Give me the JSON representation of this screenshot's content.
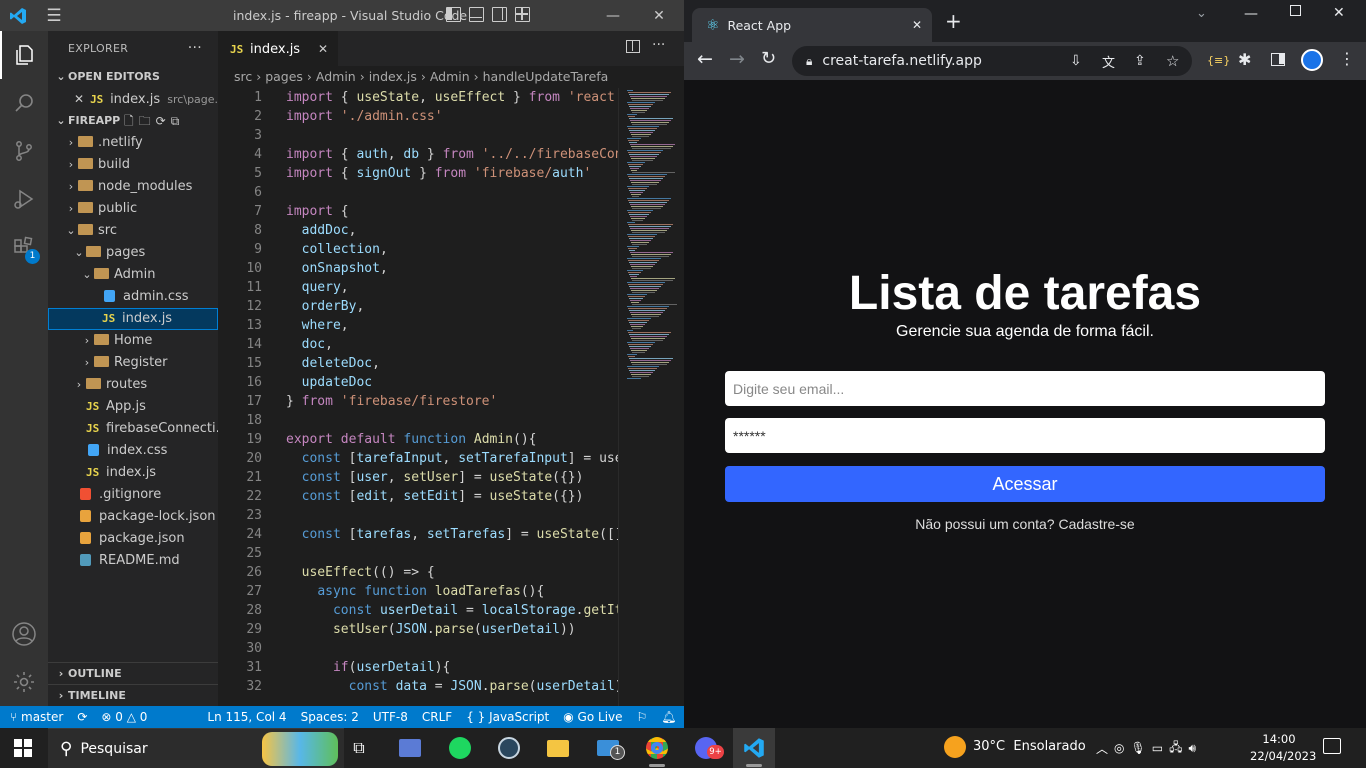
{
  "vscode": {
    "window_title": "index.js - fireapp - Visual Studio Code",
    "explorer_label": "EXPLORER",
    "open_editors_label": "OPEN EDITORS",
    "open_editor_name": "index.js",
    "open_editor_path": "src\\page...",
    "project_label": "FIREAPP",
    "tree": [
      {
        "label": ".netlify",
        "type": "folder"
      },
      {
        "label": "build",
        "type": "folder"
      },
      {
        "label": "node_modules",
        "type": "folder"
      },
      {
        "label": "public",
        "type": "folder"
      },
      {
        "label": "src",
        "type": "folder"
      },
      {
        "label": "pages",
        "type": "folder"
      },
      {
        "label": "Admin",
        "type": "folder"
      },
      {
        "label": "admin.css",
        "type": "css"
      },
      {
        "label": "index.js",
        "type": "js"
      },
      {
        "label": "Home",
        "type": "folder"
      },
      {
        "label": "Register",
        "type": "folder"
      },
      {
        "label": "routes",
        "type": "folder"
      },
      {
        "label": "App.js",
        "type": "js"
      },
      {
        "label": "firebaseConnecti...",
        "type": "js"
      },
      {
        "label": "index.css",
        "type": "css"
      },
      {
        "label": "index.js",
        "type": "js"
      },
      {
        "label": ".gitignore",
        "type": "git"
      },
      {
        "label": "package-lock.json",
        "type": "json"
      },
      {
        "label": "package.json",
        "type": "json"
      },
      {
        "label": "README.md",
        "type": "md"
      }
    ],
    "outline_label": "OUTLINE",
    "timeline_label": "TIMELINE",
    "tab_label": "index.js",
    "js_badge": "JS",
    "breadcrumb": [
      "src",
      "pages",
      "Admin",
      "index.js",
      "Admin",
      "handleUpdateTarefa"
    ],
    "code_lines": [
      "import { useState, useEffect } from 'react'",
      "import './admin.css'",
      "",
      "import { auth, db } from '../../firebaseCon",
      "import { signOut } from 'firebase/auth'",
      "",
      "import {",
      "  addDoc,",
      "  collection,",
      "  onSnapshot,",
      "  query,",
      "  orderBy,",
      "  where,",
      "  doc,",
      "  deleteDoc,",
      "  updateDoc",
      "} from 'firebase/firestore'",
      "",
      "export default function Admin(){",
      "  const [tarefaInput, setTarefaInput] = use",
      "  const [user, setUser] = useState({})",
      "  const [edit, setEdit] = useState({})",
      "",
      "  const [tarefas, setTarefas] = useState([]",
      "",
      "  useEffect(() => {",
      "    async function loadTarefas(){",
      "      const userDetail = localStorage.getIt",
      "      setUser(JSON.parse(userDetail))",
      "",
      "      if(userDetail){",
      "        const data = JSON.parse(userDetail)"
    ],
    "status": {
      "branch": "master",
      "problems": "0",
      "warnings": "0",
      "position": "Ln 115, Col 4",
      "spaces": "Spaces: 2",
      "encoding": "UTF-8",
      "eol": "CRLF",
      "language": "JavaScript",
      "golive": "Go Live"
    },
    "notification_badge": "1"
  },
  "chrome": {
    "tab_title": "React App",
    "url": "creat-tarefa.netlify.app"
  },
  "login": {
    "title": "Lista de tarefas",
    "subtitle": "Gerencie sua agenda de forma fácil.",
    "email_placeholder": "Digite seu email...",
    "password_value": "******",
    "button": "Acessar",
    "register_text": "Não possui um conta? Cadastre-se"
  },
  "taskbar": {
    "search": "Pesquisar",
    "mail_badge": "1",
    "chrome_badge": "9+",
    "weather": "30°C  Ensolarado",
    "time": "14:00",
    "date": "22/04/2023"
  }
}
